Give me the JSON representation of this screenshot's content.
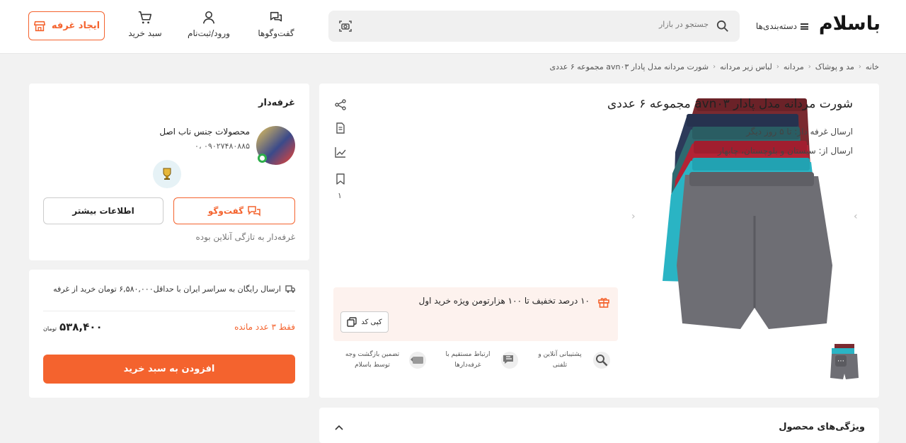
{
  "header": {
    "logo": "باسلام",
    "categories_label": "دسته‌بندی‌ها",
    "search_placeholder": "جستجو در بازار",
    "chats_label": "گفت‌وگوها",
    "login_label": "ورود/ثبت‌نام",
    "cart_label": "سبد خرید",
    "create_booth_label": "ایجاد غرفه"
  },
  "breadcrumb": [
    "خانه",
    "مد و پوشاک",
    "مردانه",
    "لباس زیر مردانه",
    "شورت مردانه مدل پادار avn۰۳ مجموعه ۶ عددی"
  ],
  "product": {
    "title": "شورت مردانه مدل پادار avn۰۳ مجموعه ۶ عددی",
    "shipping_time": "ارسال غرفه دار: تا ۵ روز دیگر",
    "shipping_from": "ارسال از: سیستان و بلوچستان، چابهار",
    "bookmark_count": "۱",
    "promo_text": "۱۰ درصد تخفیف تا ۱۰۰ هزارتومن ویژه خرید اول",
    "copy_code_label": "کپی کد",
    "features": [
      {
        "icon": "support-icon",
        "text": "پشتیبانی آنلاین و تلفنی"
      },
      {
        "icon": "chat-bubbles-icon",
        "text": "ارتباط مستقیم با غرفه‌دارها"
      },
      {
        "icon": "return-icon",
        "text": "تضمین بازگشت وجه توسط باسلام"
      }
    ],
    "specs_title": "ویژگی‌های محصول"
  },
  "vendor": {
    "section_title": "غرفه‌دار",
    "name": "محصولات جنس ناب اصل",
    "phone": "۰۹۰۲۷۴۸۰۸۸۵ ،۰",
    "chat_label": "گفت‌وگو",
    "more_info_label": "اطلاعات بیشتر",
    "online_status": "غرفه‌دار به تازگی آنلاین بوده"
  },
  "purchase": {
    "free_shipping": "ارسال رایگان به سراسر ایران با حداقل۶,۵۸۰,۰۰۰ تومان خرید از غرفه",
    "stock": "فقط ۳ عدد مانده",
    "price": "۵۳۸,۴۰۰",
    "currency": "تومان",
    "add_to_cart_label": "افزودن به سبد خرید"
  },
  "colors": {
    "accent": "#f4632e",
    "promo_bg": "#fdf2ee"
  }
}
